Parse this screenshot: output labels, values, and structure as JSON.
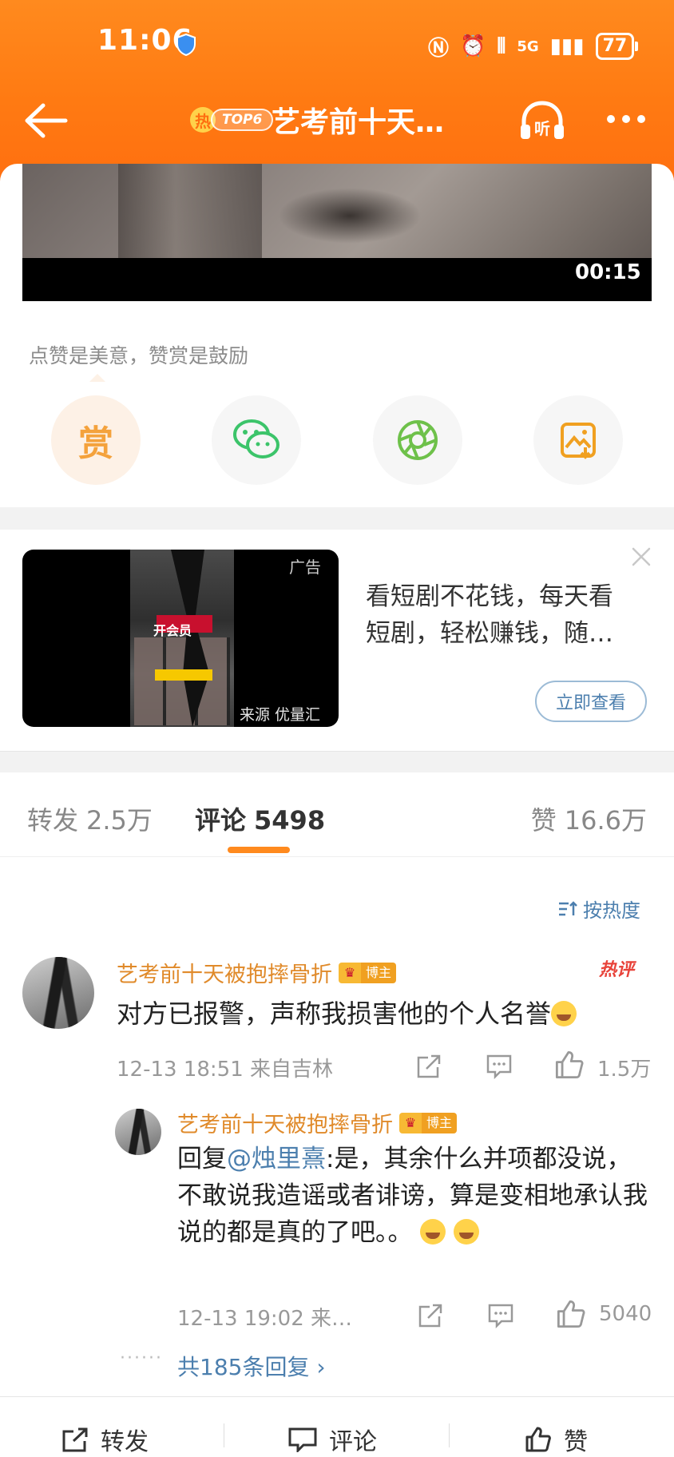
{
  "status_bar": {
    "time": "11:06",
    "network": "5G",
    "battery": "77"
  },
  "header": {
    "hot_rank": "TOP6",
    "hot_char": "热",
    "title": "艺考前十天被…",
    "listen_label": "听"
  },
  "video": {
    "duration": "00:15"
  },
  "reward": {
    "caption": "点赞是美意，赞赏是鼓励",
    "reward_label": "赏"
  },
  "ad": {
    "label": "广告",
    "member_text": "开会员",
    "source": "来源 优量汇",
    "text_line1": "看短剧不花钱，每天看",
    "text_line2": "短剧，轻松赚钱，随…",
    "button": "立即查看"
  },
  "tabs": {
    "repost": {
      "label": "转发",
      "count": "2.5万"
    },
    "comment": {
      "label": "评论",
      "count": "5498"
    },
    "like": {
      "label": "赞",
      "count": "16.6万"
    }
  },
  "sort_label": "按热度",
  "comments": [
    {
      "name": "艺考前十天被抱摔骨折",
      "badge": "博主",
      "hot_badge": "热评",
      "text": "对方已报警，声称我损害他的个人名誉",
      "meta": "12-13 18:51  来自吉林",
      "likes": "1.5万"
    },
    {
      "name": "艺考前十天被抱摔骨折",
      "badge": "博主",
      "reply_prefix": "回复",
      "mention": "@烛里熹",
      "text": ":是，其余什么并项都没说，不敢说我造谣或者诽谤，算是变相地承认我说的都是真的了吧。。",
      "meta": "12-13 19:02  来…",
      "likes": "5040"
    }
  ],
  "more_replies": "共185条回复 ›",
  "bottom_bar": {
    "repost": "转发",
    "comment": "评论",
    "like": "赞"
  }
}
